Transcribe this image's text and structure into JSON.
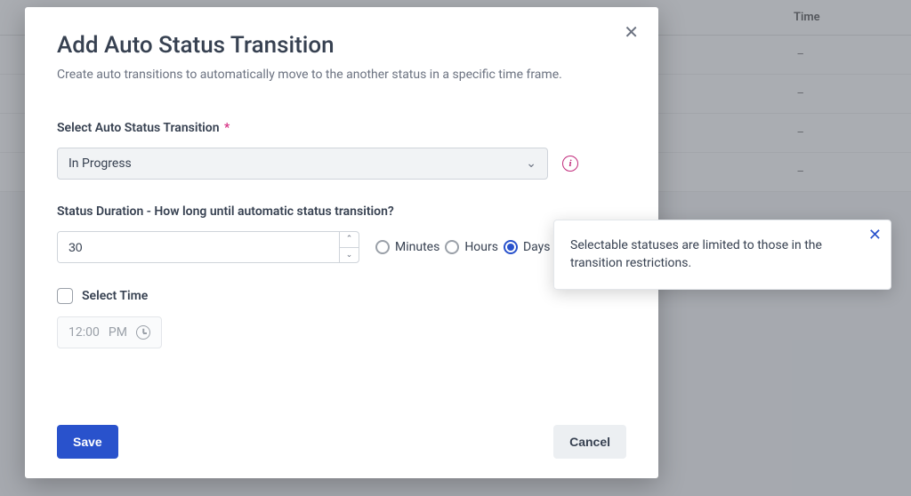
{
  "background": {
    "time_header": "Time",
    "row_placeholder": "–"
  },
  "modal": {
    "title": "Add Auto Status Transition",
    "subtitle": "Create auto transitions to automatically move to the another status in a specific time frame."
  },
  "form": {
    "status_label": "Select Auto Status Transition",
    "required_mark": "*",
    "status_value": "In Progress",
    "duration_label": "Status Duration - How long until automatic status transition?",
    "duration_value": "30",
    "unit_minutes": "Minutes",
    "unit_hours": "Hours",
    "unit_days": "Days",
    "selected_unit": "days",
    "select_time_label": "Select Time",
    "select_time_checked": false,
    "time_value": "12:00",
    "time_period": "PM"
  },
  "tooltip": {
    "text": "Selectable statuses are limited to those in the transition restrictions."
  },
  "buttons": {
    "save": "Save",
    "cancel": "Cancel"
  }
}
